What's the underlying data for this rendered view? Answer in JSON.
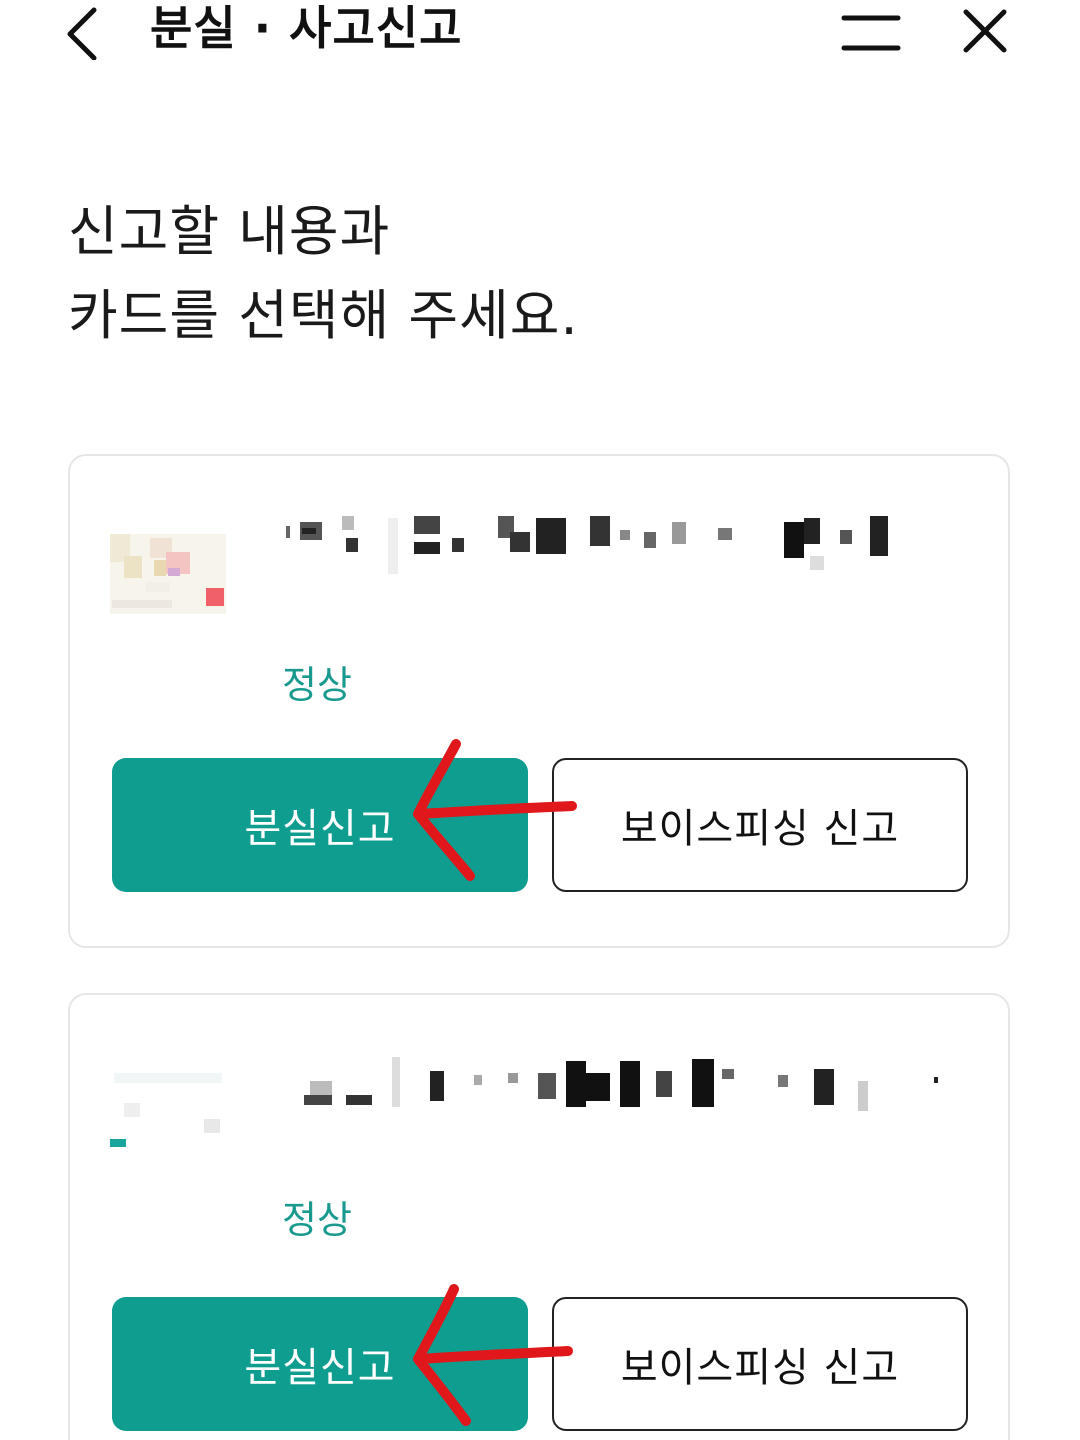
{
  "header": {
    "title": "분실 · 사고신고",
    "back_icon": "chevron-left-icon",
    "menu_icon": "menu-icon",
    "close_icon": "close-icon"
  },
  "heading": {
    "line1": "신고할 내용과",
    "line2": "카드를 선택해 주세요."
  },
  "cards": [
    {
      "status": "정상",
      "lost_report_label": "분실신고",
      "voice_phishing_label": "보이스피싱 신고"
    },
    {
      "status": "정상",
      "lost_report_label": "분실신고",
      "voice_phishing_label": "보이스피싱 신고"
    }
  ],
  "colors": {
    "accent": "#0f9d8f",
    "status": "#1a9a8e",
    "annotation_arrow": "#e0181b"
  }
}
